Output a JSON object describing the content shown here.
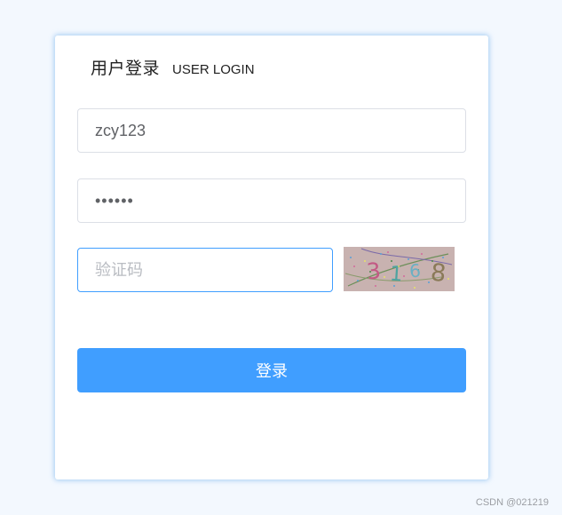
{
  "login": {
    "title_cn": "用户登录",
    "title_en": "USER LOGIN",
    "username_value": "zcy123",
    "password_value": "••••••",
    "captcha_placeholder": "验证码",
    "captcha_image_text": "3168",
    "submit_label": "登录"
  },
  "watermark": "CSDN @021219",
  "colors": {
    "accent": "#409eff",
    "page_background": "#f3f8fe",
    "card_background": "#ffffff",
    "field_border": "#dcdfe6"
  }
}
